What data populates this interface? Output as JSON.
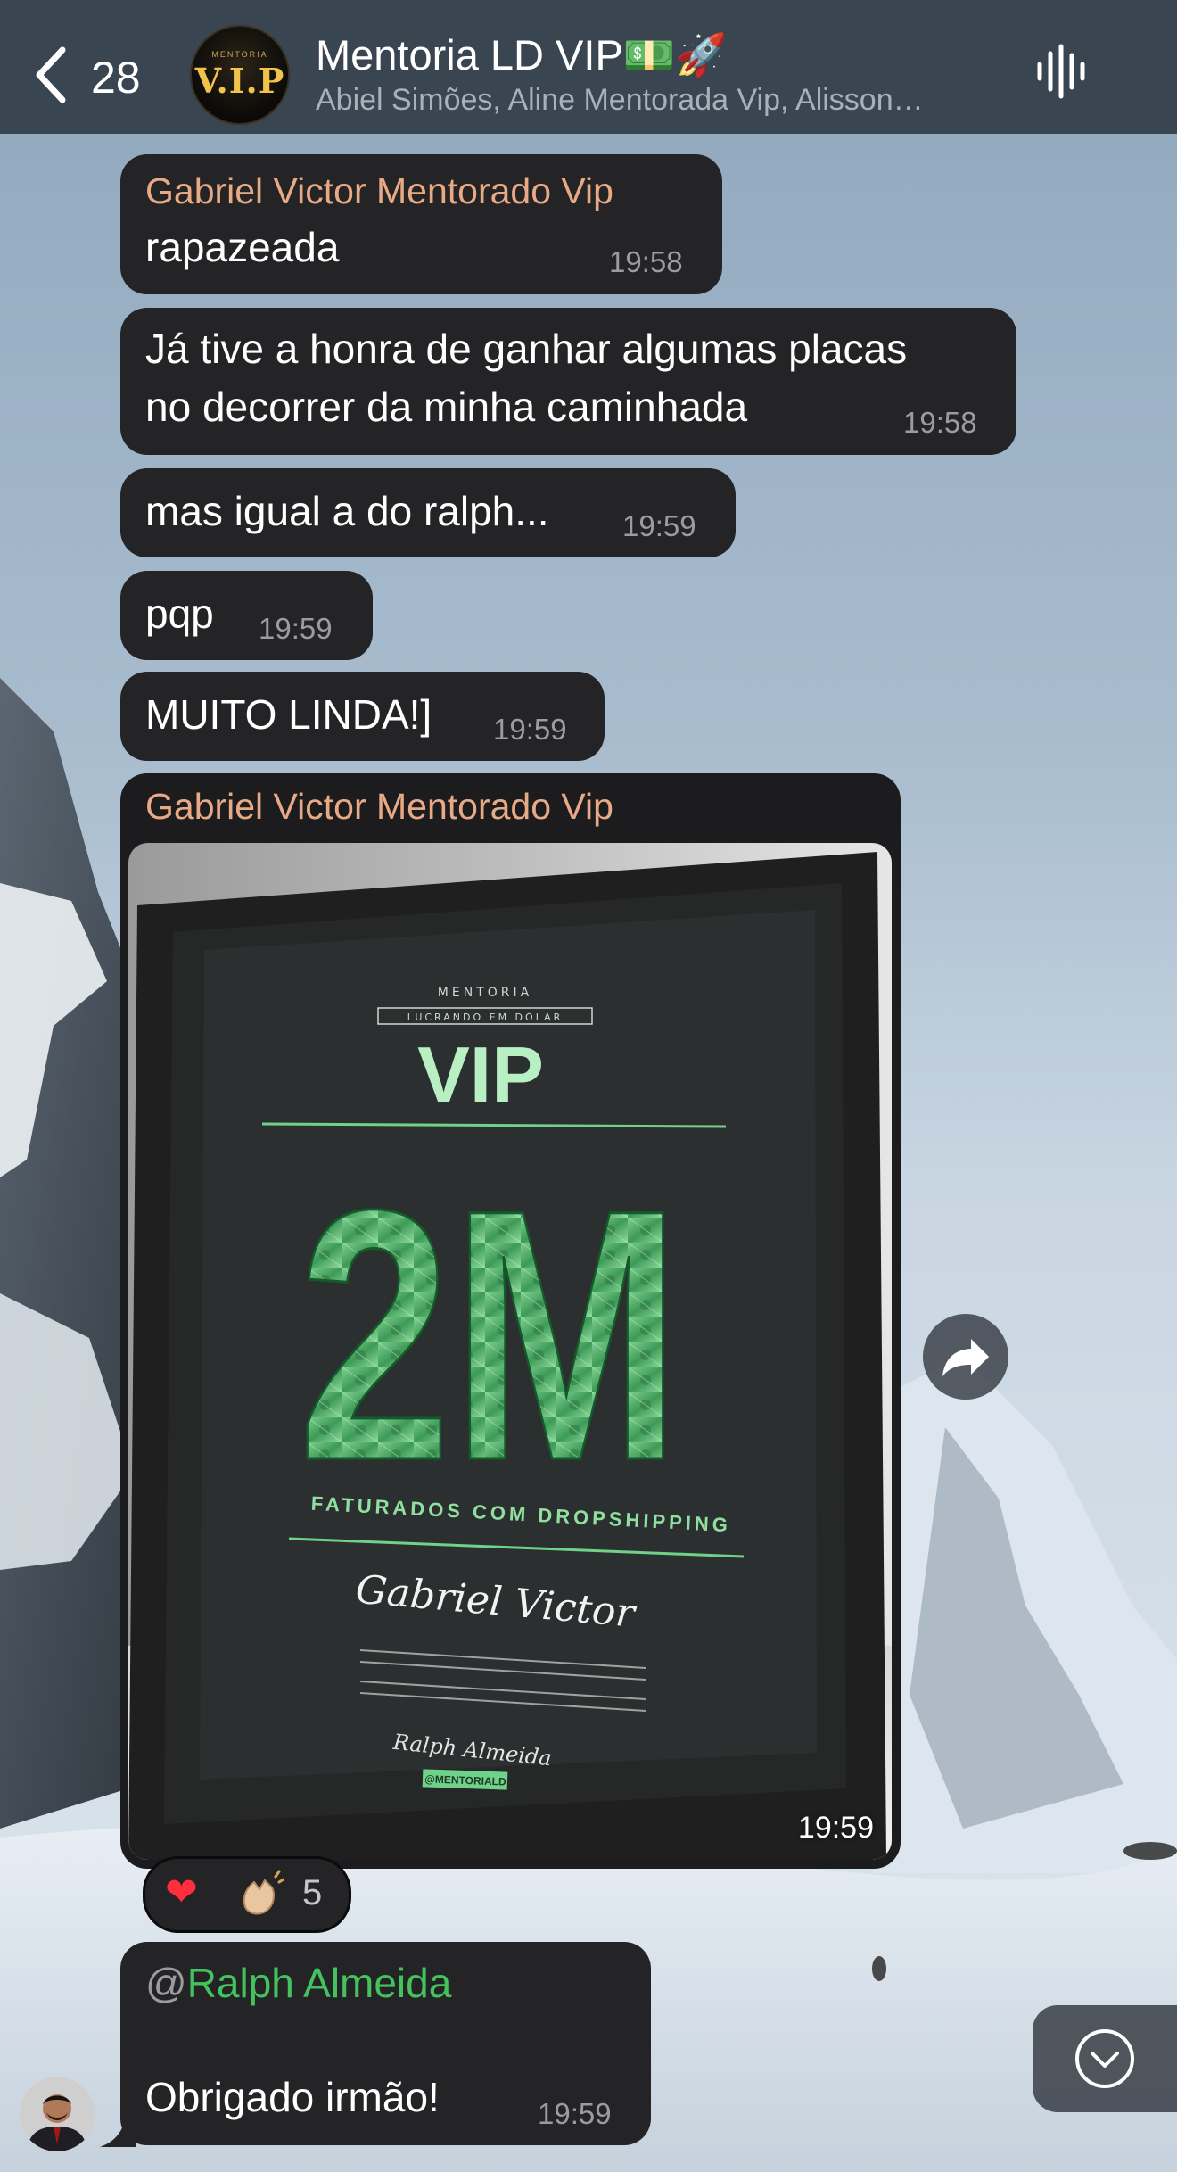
{
  "header": {
    "back_count": "28",
    "group_name": "Mentoria LD VIP💵🚀",
    "members": "Abiel Simões, Aline Mentorada Vip, Alisson…",
    "avatar_small_text": "MENTORIA",
    "avatar_text": "V.I.P"
  },
  "messages": [
    {
      "sender": "Gabriel Victor Mentorado Vip",
      "text": "rapazeada",
      "time": "19:58"
    },
    {
      "line1": "Já tive a honra de ganhar algumas placas",
      "line2": "no decorrer da minha caminhada",
      "time": "19:58"
    },
    {
      "text": "mas igual a do ralph...",
      "time": "19:59"
    },
    {
      "text": "pqp",
      "time": "19:59"
    },
    {
      "text": "MUITO LINDA!]",
      "time": "19:59"
    }
  ],
  "photo_message": {
    "sender": "Gabriel Victor Mentorado Vip",
    "time": "19:59",
    "plaque": {
      "top_small": "MENTORIA",
      "tagline": "LUCRANDO EM DÓLAR",
      "vip": "VIP",
      "big": "2M",
      "subtitle": "FATURADOS COM DROPSHIPPING",
      "name": "Gabriel Victor",
      "signature": "Ralph Almeida",
      "handle": "@MENTORIALD"
    }
  },
  "reactions": {
    "count": "5",
    "icons": [
      "heart",
      "clapping-hands"
    ]
  },
  "reply_message": {
    "mention_at": "@",
    "mention_name": "Ralph Almeida",
    "text": "Obrigado irmão!",
    "time": "19:59"
  },
  "colors": {
    "header_bg": "#343f4b",
    "bubble_bg": "#242426",
    "sender_name": "#e8a985",
    "mention": "#43c25d",
    "time": "#9b9ba0"
  }
}
